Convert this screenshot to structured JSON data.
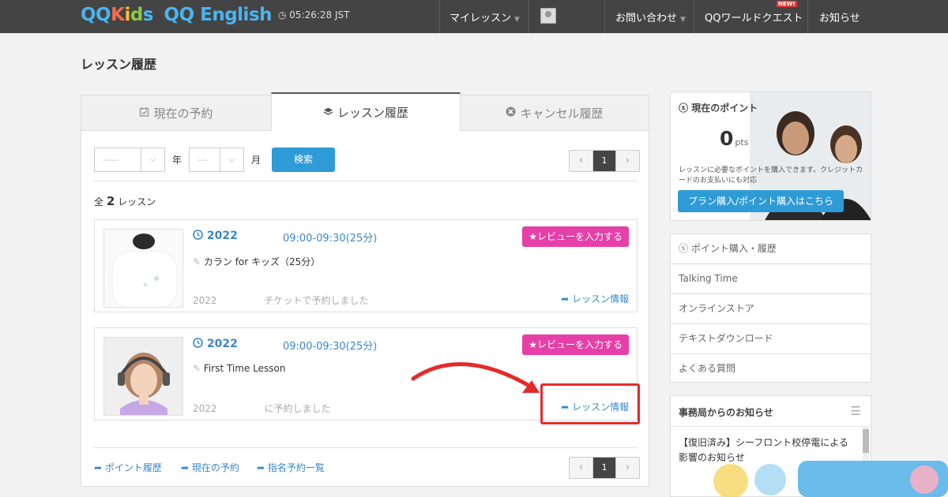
{
  "header": {
    "logo_qq1": "QQ",
    "logo_kids": [
      "K",
      "i",
      "d",
      "s"
    ],
    "logo_english": "QQ English",
    "clock": "◷ 05:26:28 JST",
    "nav": [
      "マイレッスン",
      "お問い合わせ",
      "QQワールドクエスト",
      "お知らせ"
    ],
    "new_badge": "NEW!"
  },
  "page_title": "レッスン履歴",
  "tabs": [
    {
      "label": "現在の予約",
      "icon": "calendar-check-icon"
    },
    {
      "label": "レッスン履歴",
      "icon": "stack-icon",
      "active": true
    },
    {
      "label": "キャンセル履歴",
      "icon": "x-circle-icon"
    }
  ],
  "filter": {
    "year_value": "-----",
    "year_label": "年",
    "month_value": "---",
    "month_label": "月",
    "search_label": "検索"
  },
  "pager": {
    "prev": "‹",
    "page": "1",
    "next": "›"
  },
  "total": {
    "prefix": "全",
    "count": "2",
    "suffix": "レッスン"
  },
  "lessons": [
    {
      "date": "2022",
      "time": "09:00-09:30(25分)",
      "course": "カラン for キッズ（25分）",
      "note_left": "2022",
      "note_right": "チケットで予約しました",
      "review_label": "レビューを入力する",
      "info_label": "レッスン情報"
    },
    {
      "date": "2022",
      "time": "09:00-09:30(25分)",
      "course": "First Time Lesson",
      "note_left": "2022",
      "note_right": "に予約しました",
      "review_label": "レビューを入力する",
      "info_label": "レッスン情報"
    }
  ],
  "footer_links": [
    "ポイント履歴",
    "現在の予約",
    "指名予約一覧"
  ],
  "points": {
    "title": "現在のポイント",
    "value": "0",
    "unit": "pts",
    "desc": "レッスンに必要なポイントを購入できます。クレジットカードのお支払いにも対応",
    "buy_label": "プラン購入/ポイント購入はこちら"
  },
  "side_menu": [
    "ポイント購入・履歴",
    "Talking Time",
    "オンラインストア",
    "テキストダウンロード",
    "よくある質問"
  ],
  "news": {
    "title": "事務局からのお知らせ",
    "item": "【復旧済み】シーフロント校停電による影響のお知らせ"
  },
  "colors": {
    "accent": "#2e9bd6",
    "review": "#e63fa8",
    "highlight": "#e52a2a",
    "topbar": "#444444"
  }
}
